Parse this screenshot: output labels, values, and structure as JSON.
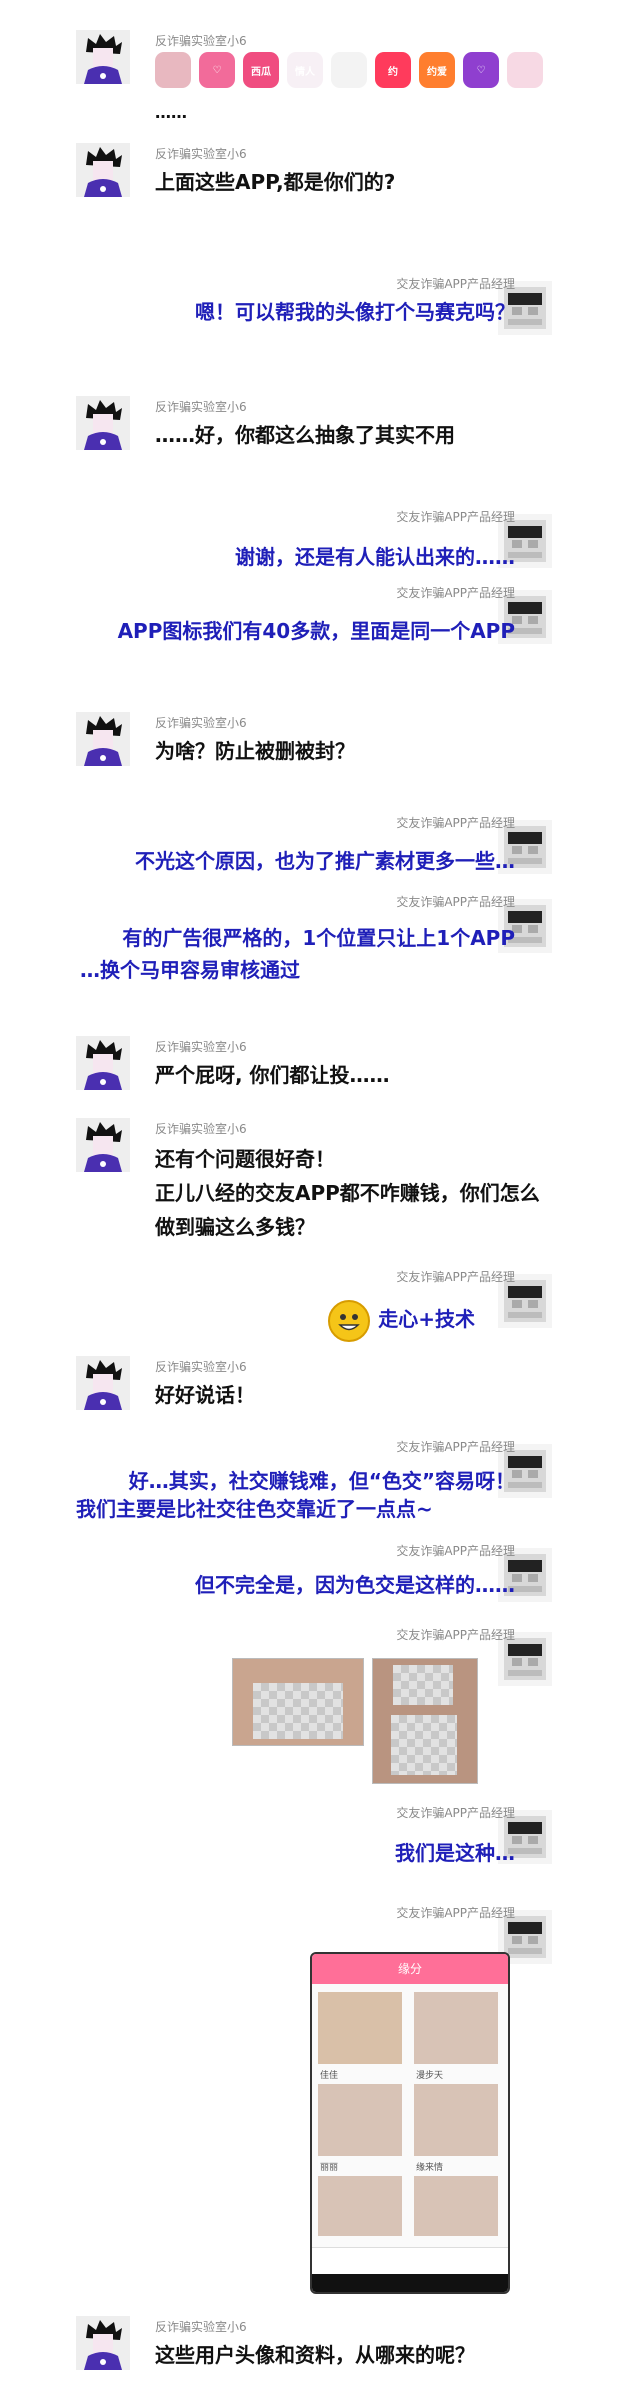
{
  "speakers": {
    "left": "反诈骗实验室小6",
    "right": "交友诈骗APP产品经理"
  },
  "messages": [
    {
      "side": "left",
      "text": "……"
    },
    {
      "side": "left",
      "text": "上面这些APP,都是你们的?"
    },
    {
      "side": "right",
      "text": "嗯！可以帮我的头像打个马赛克吗？"
    },
    {
      "side": "left",
      "text": "……好，你都这么抽象了其实不用"
    },
    {
      "side": "right",
      "text": "谢谢，还是有人能认出来的……"
    },
    {
      "side": "right",
      "text": "APP图标我们有40多款，里面是同一个APP"
    },
    {
      "side": "left",
      "text": "为啥？防止被删被封？"
    },
    {
      "side": "right",
      "text": "不光这个原因，也为了推广素材更多一些…"
    },
    {
      "side": "right",
      "text1": "有的广告很严格的，1个位置只让上1个APP",
      "text2": "…换个马甲容易审核通过"
    },
    {
      "side": "left",
      "text": "严个屁呀, 你们都让投……"
    },
    {
      "side": "left",
      "text1": "还有个问题很好奇！",
      "text2": "正儿八经的交友APP都不咋赚钱，你们怎么",
      "text3": "做到骗这么多钱？"
    },
    {
      "side": "right",
      "text": "走心+技术"
    },
    {
      "side": "left",
      "text": "好好说话！"
    },
    {
      "side": "right",
      "text1": "好…其实，社交赚钱难，但“色交”容易呀！",
      "text2": "我们主要是比社交往色交靠近了一点点~"
    },
    {
      "side": "right",
      "text": "但不完全是，因为色交是这样的……"
    },
    {
      "side": "right",
      "text": "我们是这种…"
    },
    {
      "side": "left",
      "text": "这些用户头像和资料，从哪来的呢？"
    }
  ],
  "app_icons": [
    {
      "label": "",
      "color": "#e8b8c0"
    },
    {
      "label": "♡",
      "color": "#f26b9a"
    },
    {
      "label": "西瓜",
      "color": "#f04d80"
    },
    {
      "label": "情人",
      "color": "#f7f0f5"
    },
    {
      "label": "",
      "color": "#f3f3f3"
    },
    {
      "label": "约",
      "color": "#ff3b5c"
    },
    {
      "label": "约爱",
      "color": "#ff7e2e"
    },
    {
      "label": "♡",
      "color": "#8f3fcf"
    },
    {
      "label": "",
      "color": "#f7d9e4"
    }
  ],
  "phone_screen": {
    "title": "缘分",
    "cells": [
      "佳佳",
      "漫步天",
      "丽丽",
      "缘来情",
      "",
      ""
    ]
  }
}
